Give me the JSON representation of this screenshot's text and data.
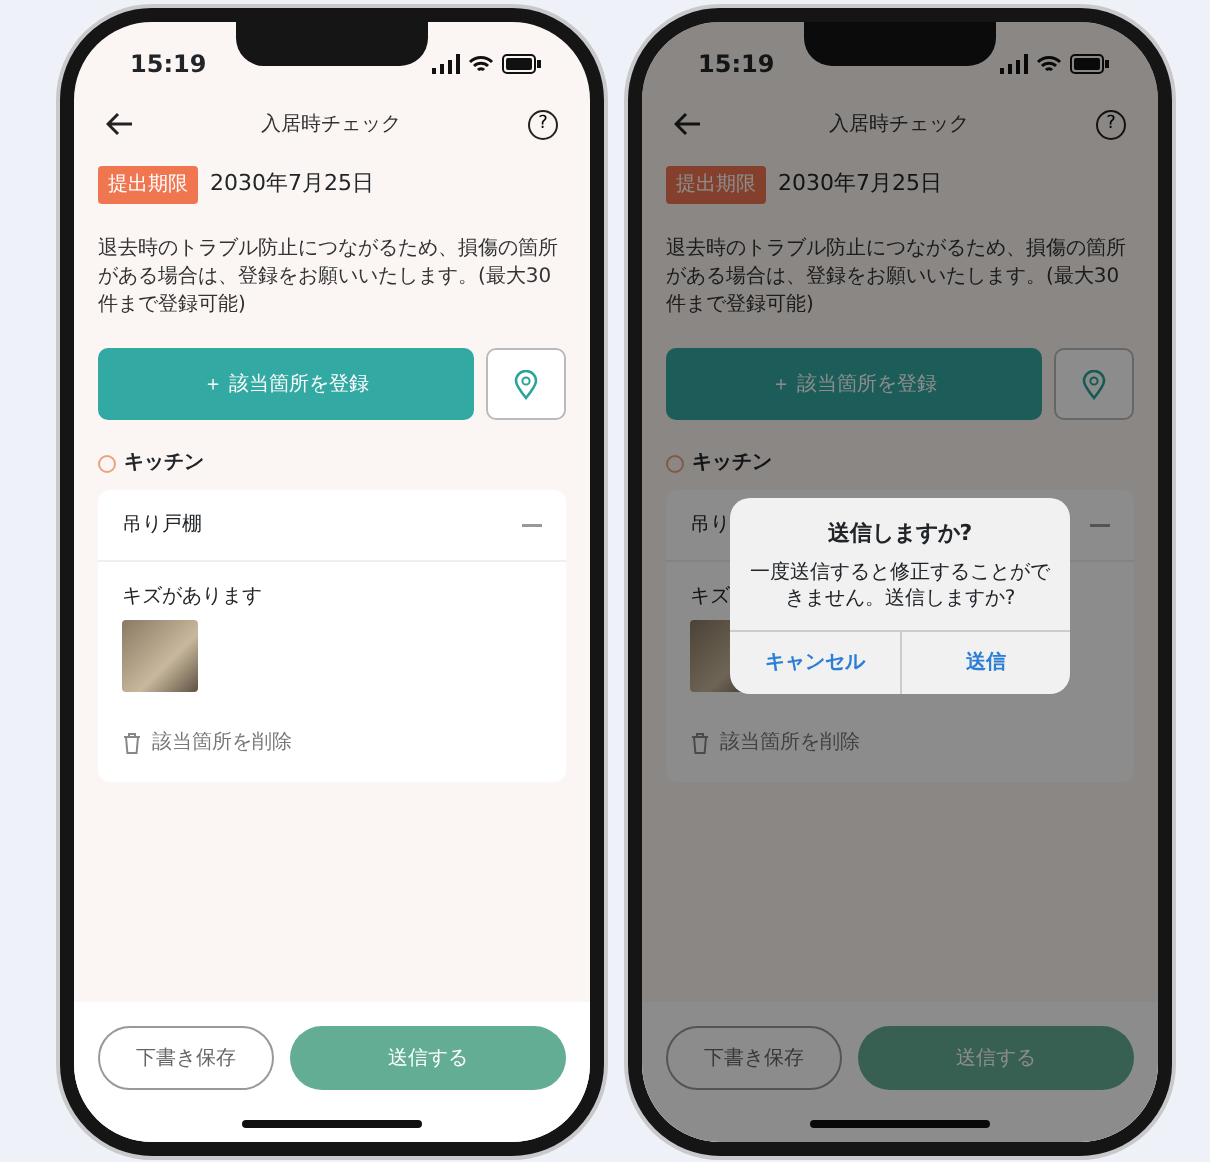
{
  "screens": [
    {
      "status_time": "15:19",
      "nav": {
        "title": "入居時チェック",
        "help": "?"
      },
      "deadline": {
        "badge": "提出期限",
        "date": "2030年7月25日"
      },
      "notice": "退去時のトラブル防止につながるため、損傷の箇所がある場合は、登録をお願いいたします。(最大30件まで登録可能)",
      "add_button": "＋ 該当箇所を登録",
      "section": {
        "name": "キッチン",
        "items": [
          {
            "title": "吊り戸棚",
            "comment": "キズがあります"
          }
        ]
      },
      "delete_link": "該当箇所を削除",
      "footer": {
        "draft": "下書き保存",
        "submit": "送信する"
      }
    },
    {
      "status_time": "15:19",
      "nav": {
        "title": "入居時チェック",
        "help": "?"
      },
      "deadline": {
        "badge": "提出期限",
        "date": "2030年7月25日"
      },
      "notice": "退去時のトラブル防止につながるため、損傷の箇所がある場合は、登録をお願いいたします。(最大30件まで登録可能)",
      "add_button": "＋ 該当箇所を登録",
      "section": {
        "name": "キッチン",
        "items": [
          {
            "title": "吊り",
            "comment": "キズ"
          }
        ]
      },
      "delete_link": "該当箇所を削除",
      "footer": {
        "draft": "下書き保存",
        "submit": "送信する"
      },
      "dialog": {
        "title": "送信しますか?",
        "message": "一度送信すると修正することができません。送信しますか?",
        "buttons": [
          "キャンセル",
          "送信"
        ]
      }
    }
  ]
}
